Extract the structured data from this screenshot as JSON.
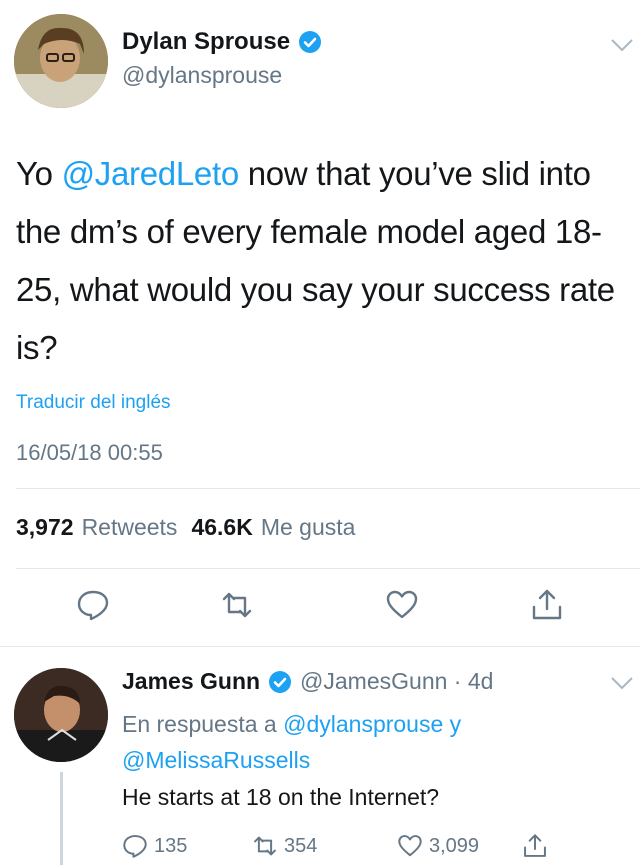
{
  "main_tweet": {
    "display_name": "Dylan Sprouse",
    "handle": "@dylansprouse",
    "text_parts": {
      "pre": "Yo ",
      "mention": "@JaredLeto",
      "post": " now that you’ve slid into the dm’s of every female model aged 18-25, what would you say your success rate is?"
    },
    "translate_label": "Traducir del inglés",
    "timestamp": "16/05/18 00:55",
    "stats": {
      "retweets_count": "3,972",
      "retweets_label": "Retweets",
      "likes_count": "46.6K",
      "likes_label": "Me gusta"
    },
    "icons": [
      "reply-icon",
      "retweet-icon",
      "like-icon",
      "share-icon"
    ]
  },
  "reply_tweet": {
    "display_name": "James Gunn",
    "handle": "@JamesGunn · 4d",
    "reply_to_prefix": "En respuesta a",
    "reply_to_mention_1": "@dylansprouse",
    "reply_to_joiner": "y",
    "reply_to_mention_2": "@MelissaRussells",
    "text": "He starts at 18 on the Internet?",
    "actions": {
      "replies": "135",
      "retweets": "354",
      "likes": "3,099"
    }
  },
  "colors": {
    "accent": "#1da1f2",
    "secondary_text": "#657786",
    "primary_text": "#14171a",
    "divider": "#e1e8ed"
  }
}
